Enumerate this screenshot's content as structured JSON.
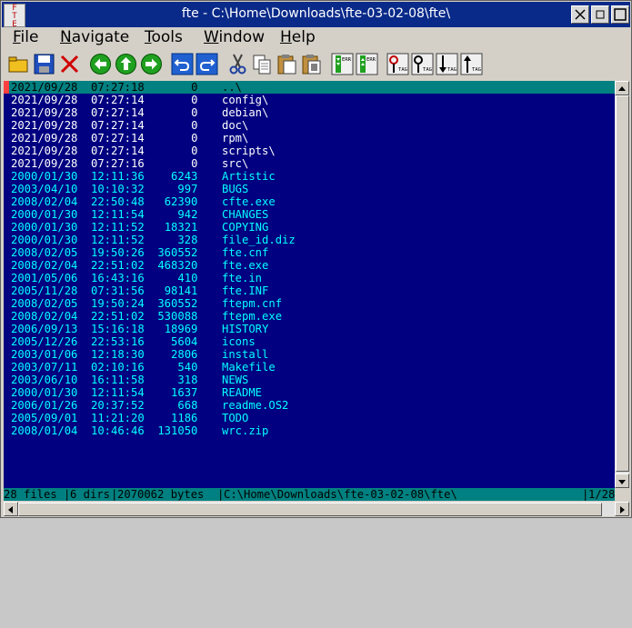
{
  "window": {
    "title": "fte - C:\\Home\\Downloads\\fte-03-02-08\\fte\\",
    "icon_letters": [
      "F",
      "T",
      "E"
    ]
  },
  "menu": [
    {
      "label": "File",
      "underline": "F",
      "rest": "ile"
    },
    {
      "label": "Navigate",
      "underline": "N",
      "rest": "avigate"
    },
    {
      "label": "Tools",
      "underline": "T",
      "rest": "ools"
    },
    {
      "label": "Window",
      "underline": "W",
      "rest": "indow"
    },
    {
      "label": "Help",
      "underline": "H",
      "rest": "elp"
    }
  ],
  "toolbar": {
    "icons": [
      "open-folder-icon",
      "save-icon",
      "close-icon",
      "back-icon",
      "up-icon",
      "forward-icon",
      "undo-icon",
      "redo-icon",
      "cut-icon",
      "copy-icon",
      "paste-icon",
      "paste-block-icon",
      "next-error-icon",
      "previous-error-icon",
      "tag-find-icon",
      "tag-find-prompt-icon",
      "tag-next-icon",
      "tag-previous-icon"
    ],
    "err_label": "ERR",
    "tag_label": "TAG"
  },
  "files": [
    {
      "date": "2021/09/28",
      "time": "07:27:18",
      "size": "0",
      "name": "..\\"
    },
    {
      "date": "2021/09/28",
      "time": "07:27:14",
      "size": "0",
      "name": "config\\"
    },
    {
      "date": "2021/09/28",
      "time": "07:27:14",
      "size": "0",
      "name": "debian\\"
    },
    {
      "date": "2021/09/28",
      "time": "07:27:14",
      "size": "0",
      "name": "doc\\"
    },
    {
      "date": "2021/09/28",
      "time": "07:27:14",
      "size": "0",
      "name": "rpm\\"
    },
    {
      "date": "2021/09/28",
      "time": "07:27:14",
      "size": "0",
      "name": "scripts\\"
    },
    {
      "date": "2021/09/28",
      "time": "07:27:16",
      "size": "0",
      "name": "src\\"
    },
    {
      "date": "2000/01/30",
      "time": "12:11:36",
      "size": "6243",
      "name": "Artistic"
    },
    {
      "date": "2003/04/10",
      "time": "10:10:32",
      "size": "997",
      "name": "BUGS"
    },
    {
      "date": "2008/02/04",
      "time": "22:50:48",
      "size": "62390",
      "name": "cfte.exe"
    },
    {
      "date": "2000/01/30",
      "time": "12:11:54",
      "size": "942",
      "name": "CHANGES"
    },
    {
      "date": "2000/01/30",
      "time": "12:11:52",
      "size": "18321",
      "name": "COPYING"
    },
    {
      "date": "2000/01/30",
      "time": "12:11:52",
      "size": "328",
      "name": "file_id.diz"
    },
    {
      "date": "2008/02/05",
      "time": "19:50:26",
      "size": "360552",
      "name": "fte.cnf"
    },
    {
      "date": "2008/02/04",
      "time": "22:51:02",
      "size": "468320",
      "name": "fte.exe"
    },
    {
      "date": "2001/05/06",
      "time": "16:43:16",
      "size": "410",
      "name": "fte.in"
    },
    {
      "date": "2005/11/28",
      "time": "07:31:56",
      "size": "98141",
      "name": "fte.INF"
    },
    {
      "date": "2008/02/05",
      "time": "19:50:24",
      "size": "360552",
      "name": "ftepm.cnf"
    },
    {
      "date": "2008/02/04",
      "time": "22:51:02",
      "size": "530088",
      "name": "ftepm.exe"
    },
    {
      "date": "2006/09/13",
      "time": "15:16:18",
      "size": "18969",
      "name": "HISTORY"
    },
    {
      "date": "2005/12/26",
      "time": "22:53:16",
      "size": "5604",
      "name": "icons"
    },
    {
      "date": "2003/01/06",
      "time": "12:18:30",
      "size": "2806",
      "name": "install"
    },
    {
      "date": "2003/07/11",
      "time": "02:10:16",
      "size": "540",
      "name": "Makefile"
    },
    {
      "date": "2003/06/10",
      "time": "16:11:58",
      "size": "318",
      "name": "NEWS"
    },
    {
      "date": "2000/01/30",
      "time": "12:11:54",
      "size": "1637",
      "name": "README"
    },
    {
      "date": "2006/01/26",
      "time": "20:37:52",
      "size": "668",
      "name": "readme.OS2"
    },
    {
      "date": "2005/09/01",
      "time": "11:21:20",
      "size": "1186",
      "name": "TODO"
    },
    {
      "date": "2008/01/04",
      "time": "10:46:46",
      "size": "131050",
      "name": "wrc.zip"
    }
  ],
  "status": {
    "files": "28 files",
    "dirs": "6 dirs",
    "bytes": "2070062 bytes",
    "path": "C:\\Home\\Downloads\\fte-03-02-08\\fte\\",
    "position": "1/28"
  },
  "colors": {
    "background": "#000080",
    "dir_text": "#ffffff",
    "file_text": "#00ffff",
    "selection": "#008080",
    "title_bar": "#0a2a8a"
  }
}
